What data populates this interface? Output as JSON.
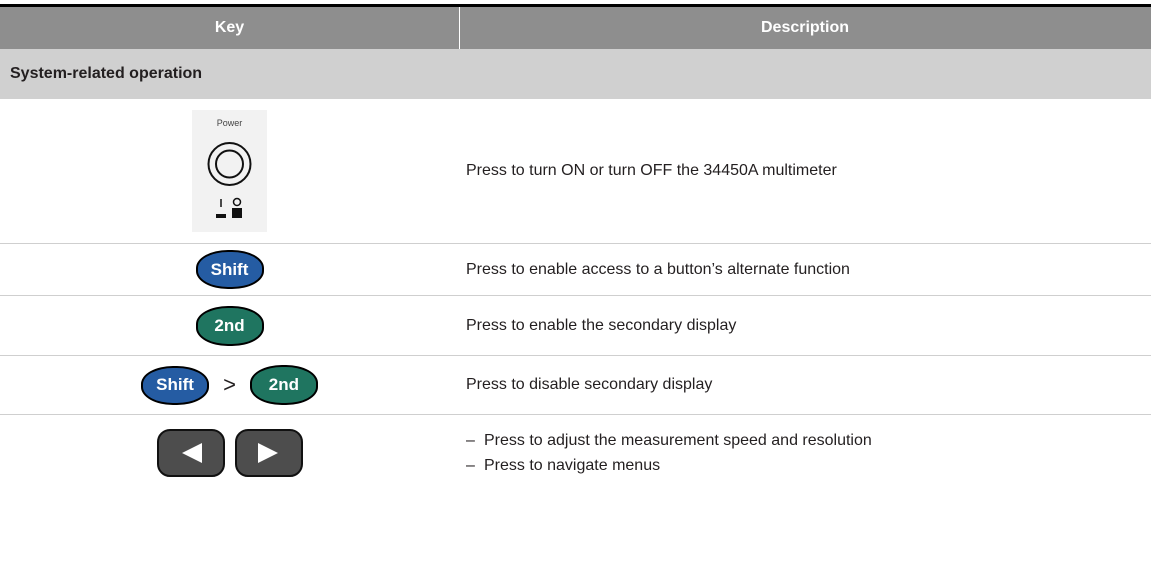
{
  "header": {
    "key": "Key",
    "description": "Description"
  },
  "section": {
    "title": "System-related operation"
  },
  "rows": [
    {
      "key_text": "Power",
      "description": "Press to turn ON or turn OFF the 34450A multimeter"
    },
    {
      "key_text": "Shift",
      "description": "Press to enable access to a button’s alternate function"
    },
    {
      "key_text": "2nd",
      "description": "Press to enable the secondary display"
    },
    {
      "key_text": [
        "Shift",
        ">",
        "2nd"
      ],
      "description": "Press to disable secondary display"
    },
    {
      "bullets": [
        {
          "dash": "–",
          "text": "Press to adjust the measurement speed and resolution"
        },
        {
          "dash": "–",
          "text": "Press to navigate menus"
        }
      ]
    }
  ],
  "icons": {
    "power": "power-button-icon",
    "left": "left-arrow-icon",
    "right": "right-arrow-icon"
  },
  "colors": {
    "header": "#8e8e8e",
    "section": "#d0d0d0",
    "shift": "#255ca3",
    "second": "#1f7560",
    "arrow": "#4d4d4d"
  }
}
